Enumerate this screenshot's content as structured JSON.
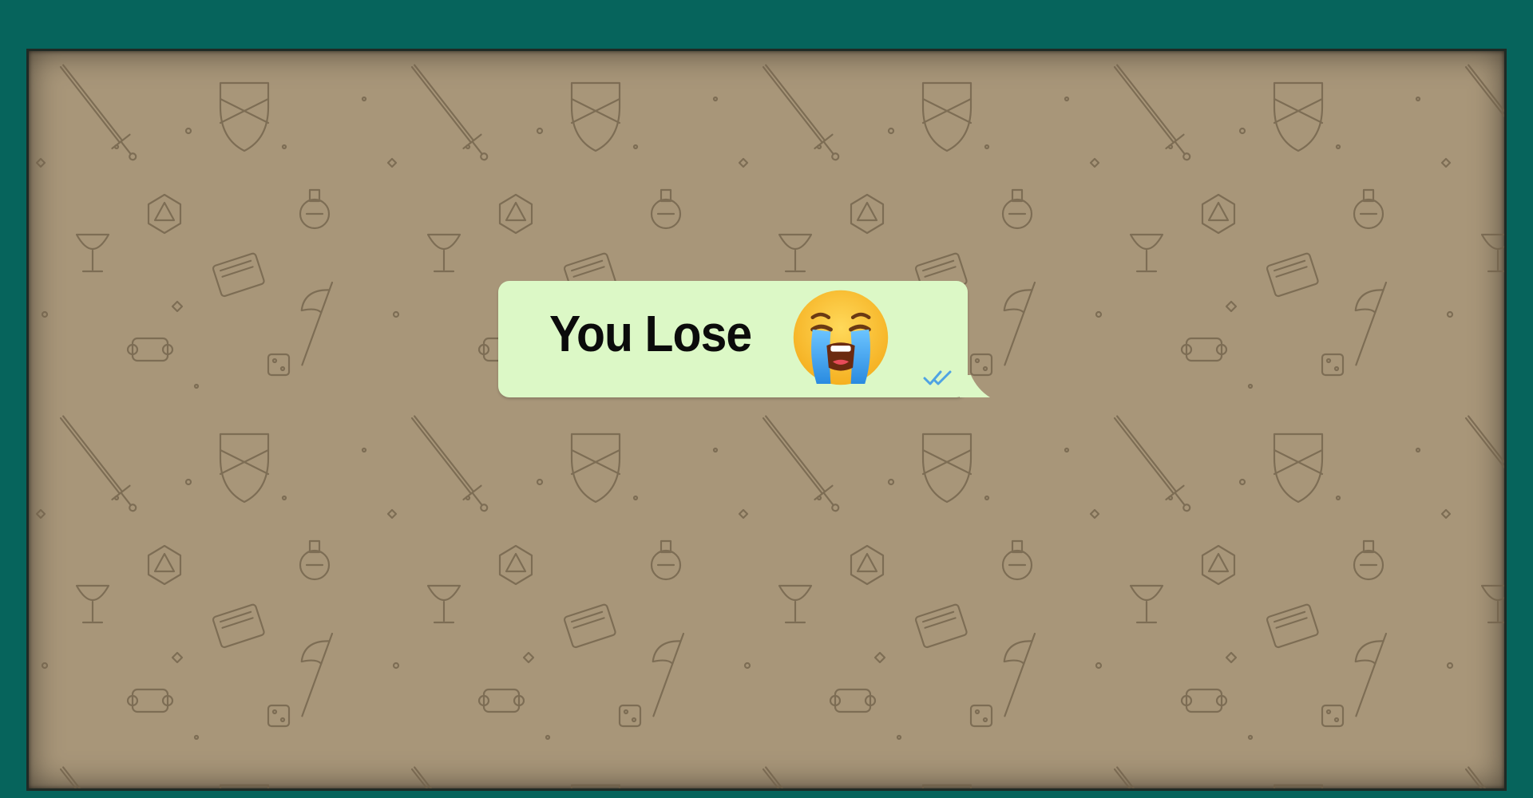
{
  "game": {
    "background_theme": "tabletop-rpg-doodle-wallpaper",
    "result_message": "You Lose",
    "result_emoji": "loudly-crying-face-icon",
    "message_status": "read",
    "status_icon": "double-check-icon"
  },
  "colors": {
    "border": "#06645c",
    "wallpaper": "#a89679",
    "doodle": "#6e5f48",
    "bubble": "#dcf8c6",
    "text": "#0b0b0b",
    "read_check": "#4fa3e3",
    "emoji_face": "#ffc83d",
    "emoji_tears": "#3aa0f0"
  }
}
